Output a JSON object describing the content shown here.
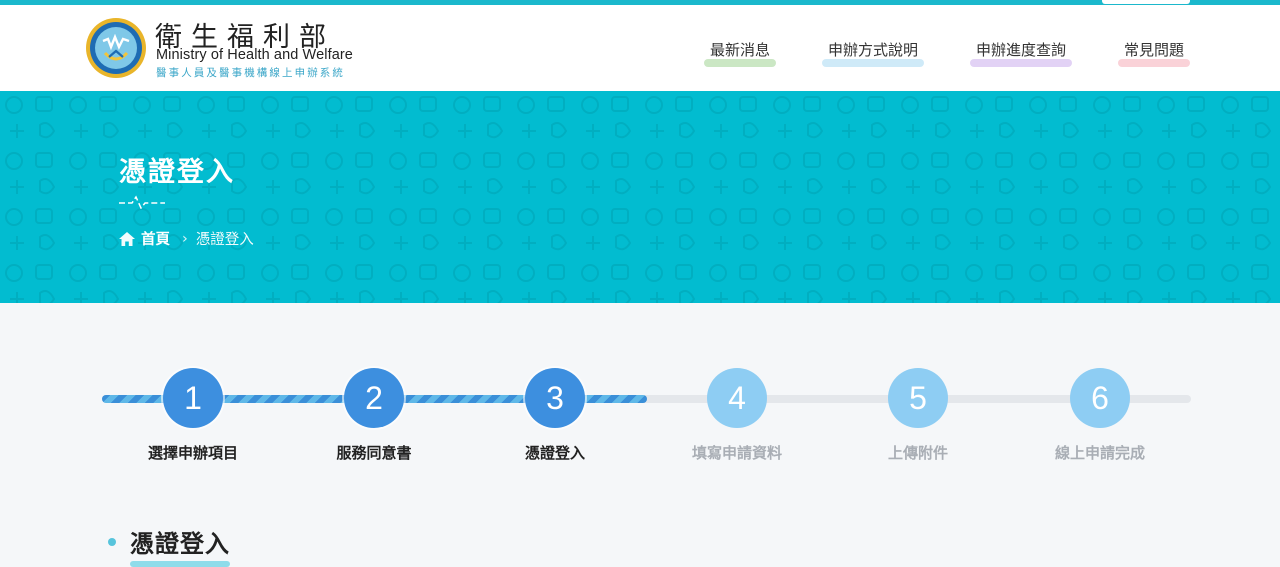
{
  "brand": {
    "name_zh": "衛生福利部",
    "name_en": "Ministry of Health and Welfare",
    "subtitle": "醫事人員及醫事機構線上申辦系統"
  },
  "nav": [
    {
      "label": "最新消息",
      "color": "#b9dfb0"
    },
    {
      "label": "申辦方式說明",
      "color": "#bfe3f5"
    },
    {
      "label": "申辦進度查詢",
      "color": "#d8c3f2"
    },
    {
      "label": "常見問題",
      "color": "#f8c3cb"
    }
  ],
  "hero": {
    "title": "憑證登入",
    "breadcrumb": {
      "home": "首頁",
      "current": "憑證登入"
    }
  },
  "steps": {
    "progress": 0.5,
    "items": [
      {
        "num": "1",
        "label": "選擇申辦項目",
        "state": "done"
      },
      {
        "num": "2",
        "label": "服務同意書",
        "state": "done"
      },
      {
        "num": "3",
        "label": "憑證登入",
        "state": "done"
      },
      {
        "num": "4",
        "label": "填寫申請資料",
        "state": "todo"
      },
      {
        "num": "5",
        "label": "上傳附件",
        "state": "todo"
      },
      {
        "num": "6",
        "label": "線上申請完成",
        "state": "todo"
      }
    ]
  },
  "section": {
    "title": "憑證登入"
  },
  "colors": {
    "hero": "#02bcd0",
    "step_done": "#3d8fdf",
    "step_todo": "#8ecdf3"
  }
}
